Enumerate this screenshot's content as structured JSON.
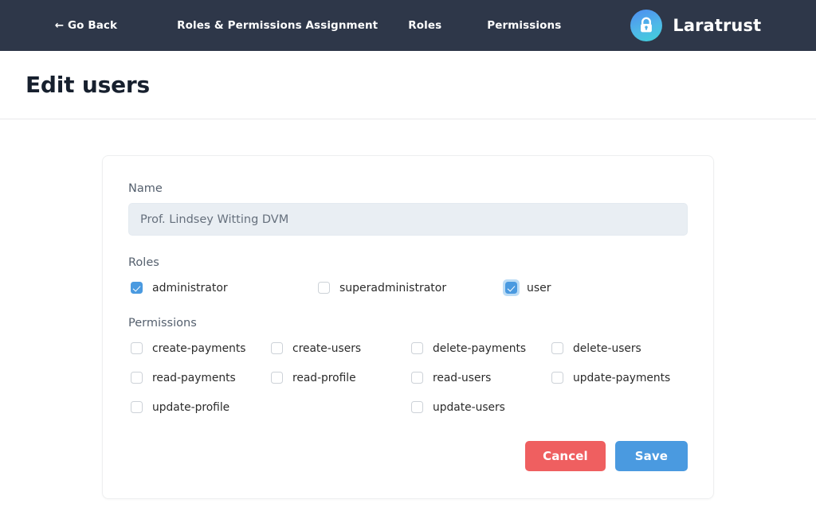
{
  "navbar": {
    "links": [
      {
        "label": "← Go Back",
        "name": "nav-go-back"
      },
      {
        "label": "Roles & Permissions Assignment",
        "name": "nav-roles-permissions-assignment"
      },
      {
        "label": "Roles",
        "name": "nav-roles"
      },
      {
        "label": "Permissions",
        "name": "nav-permissions"
      }
    ],
    "brand": {
      "name": "Laratrust",
      "icon": "lock-icon",
      "logo_gradient_from": "#4d8cf0",
      "logo_gradient_to": "#3fd0d8"
    },
    "background_color": "#2e3749"
  },
  "page": {
    "title": "Edit users"
  },
  "form": {
    "name_field": {
      "label": "Name",
      "value": "Prof. Lindsey Witting DVM",
      "placeholder": "Name"
    },
    "roles": {
      "label": "Roles",
      "items": [
        {
          "label": "administrator",
          "checked": true,
          "focused": false
        },
        {
          "label": "superadministrator",
          "checked": false,
          "focused": false
        },
        {
          "label": "user",
          "checked": true,
          "focused": true
        }
      ]
    },
    "permissions": {
      "label": "Permissions",
      "items": [
        {
          "label": "create-payments",
          "checked": false
        },
        {
          "label": "create-users",
          "checked": false
        },
        {
          "label": "delete-payments",
          "checked": false
        },
        {
          "label": "delete-users",
          "checked": false
        },
        {
          "label": "read-payments",
          "checked": false
        },
        {
          "label": "read-profile",
          "checked": false
        },
        {
          "label": "read-users",
          "checked": false
        },
        {
          "label": "update-payments",
          "checked": false
        },
        {
          "label": "update-profile",
          "checked": false
        },
        {
          "label": "",
          "checked": false,
          "empty": true
        },
        {
          "label": "update-users",
          "checked": false
        },
        {
          "label": "",
          "checked": false,
          "empty": true
        }
      ]
    },
    "actions": {
      "cancel_label": "Cancel",
      "save_label": "Save",
      "cancel_color": "#ef5f60",
      "save_color": "#4a9ae0"
    }
  }
}
